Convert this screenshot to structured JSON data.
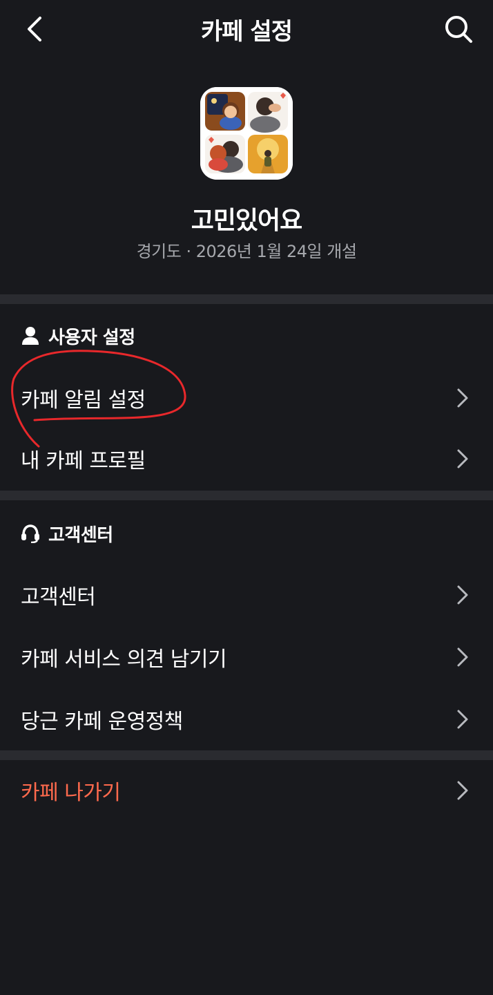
{
  "header": {
    "title": "카페 설정",
    "back_icon": "chevron-left-icon",
    "search_icon": "search-icon"
  },
  "cafe": {
    "name": "고민있어요",
    "meta": "경기도 · 2026년 1월 24일 개설"
  },
  "sections": {
    "user": {
      "title": "사용자 설정",
      "icon": "person-icon",
      "items": [
        {
          "label": "카페 알림 설정"
        },
        {
          "label": "내 카페 프로필"
        }
      ]
    },
    "support": {
      "title": "고객센터",
      "icon": "headset-icon",
      "items": [
        {
          "label": "고객센터"
        },
        {
          "label": "카페 서비스 의견 남기기"
        },
        {
          "label": "당근 카페 운영정책"
        }
      ]
    },
    "leave": {
      "label": "카페 나가기"
    }
  },
  "colors": {
    "background": "#18191d",
    "divider": "#2a2b30",
    "danger": "#ff6a4d",
    "annotation": "#e8282b"
  }
}
